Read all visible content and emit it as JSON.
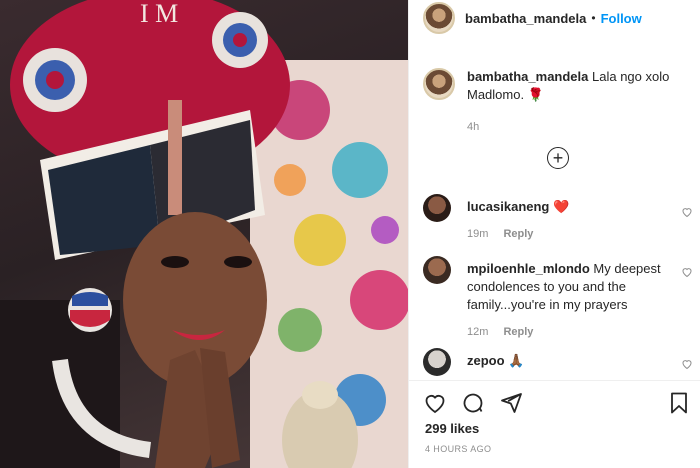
{
  "post": {
    "author": "bambatha_mandela",
    "follow_label": "Follow",
    "separator": "•",
    "caption": {
      "username": "bambatha_mandela",
      "text": "Lala ngo xolo Madlomo. 🌹",
      "time": "4h"
    },
    "load_more_icon": "plus-circle-icon"
  },
  "comments": [
    {
      "username": "lucasikaneng",
      "text": "❤️",
      "time": "19m",
      "reply": "Reply"
    },
    {
      "username": "mpiloenhle_mlondo",
      "text": "My deepest condolences to you and the family...you're in my prayers",
      "time": "12m",
      "reply": "Reply"
    },
    {
      "username": "zepoo",
      "text": "🙏🏾"
    }
  ],
  "actions": {
    "icons": [
      "heart-icon",
      "comment-icon",
      "share-icon",
      "bookmark-icon"
    ],
    "likes": "299 likes",
    "timestamp": "4 HOURS AGO"
  },
  "colors": {
    "follow": "#0095f6",
    "text": "#262626",
    "secondary": "#8e8e8e",
    "divider": "#efefef"
  }
}
